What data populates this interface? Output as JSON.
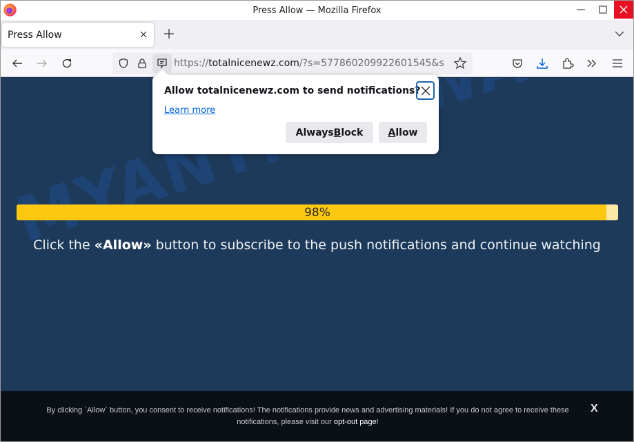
{
  "window": {
    "title": "Press Allow — Mozilla Firefox",
    "controls": {
      "minimize": "—",
      "maximize": "☐",
      "close": "✕"
    }
  },
  "tabs": [
    {
      "label": "Press Allow",
      "active": true
    }
  ],
  "navbar": {
    "url_scheme": "https://",
    "url_domain": "totalnicenewz.com",
    "url_rest": "/?s=577860209922601545&s",
    "icons": [
      "back-icon",
      "forward-icon",
      "reload-icon",
      "shield-icon",
      "lock-icon",
      "notification-permission-icon",
      "bookmark-star-icon",
      "pocket-icon",
      "downloads-icon",
      "extensions-icon",
      "overflow-icon",
      "menu-icon"
    ]
  },
  "popup": {
    "title": "Allow totalnicenewz.com to send notifications?",
    "learn_more": "Learn more",
    "block_pre": "Always ",
    "block_key": "B",
    "block_post": "lock",
    "allow_key": "A",
    "allow_post": "llow"
  },
  "page": {
    "watermark": "MYANTISPYWARE.COM",
    "progress_percent": 98,
    "progress_label": "98%",
    "cta_pre": "Click the ",
    "cta_bold": "«Allow»",
    "cta_post": " button to subscribe to the push notifications and continue watching",
    "colors": {
      "background": "#1e3a5a",
      "progress_fill": "#fbc70f",
      "progress_track": "#fde9a6"
    }
  },
  "consent": {
    "text": "By clicking `Allow` button, you consent to receive notifications! The notifications provide news and advertising materials! If you do not agree to receive these notifications, please visit our ",
    "link": "opt-out page",
    "suffix": "!",
    "close": "X"
  }
}
